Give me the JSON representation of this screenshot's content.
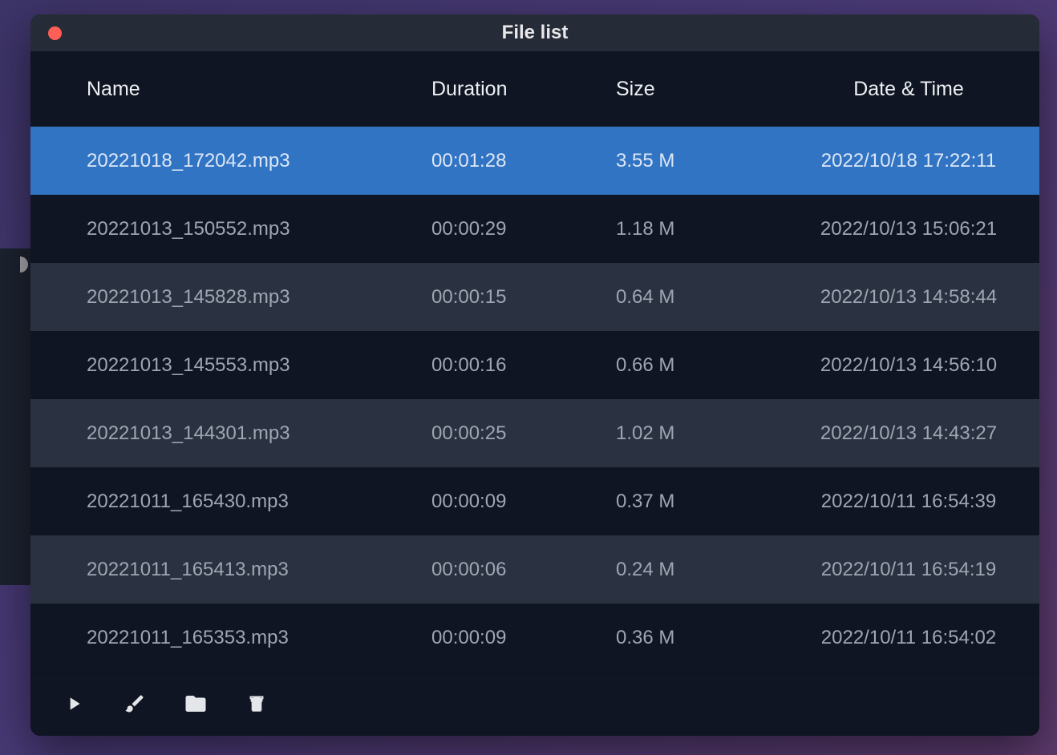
{
  "window": {
    "title": "File list"
  },
  "columns": {
    "name": "Name",
    "duration": "Duration",
    "size": "Size",
    "datetime": "Date & Time"
  },
  "files": [
    {
      "name": "20221018_172042.mp3",
      "duration": "00:01:28",
      "size": "3.55 M",
      "datetime": "2022/10/18 17:22:11",
      "selected": true
    },
    {
      "name": "20221013_150552.mp3",
      "duration": "00:00:29",
      "size": "1.18 M",
      "datetime": "2022/10/13 15:06:21",
      "selected": false
    },
    {
      "name": "20221013_145828.mp3",
      "duration": "00:00:15",
      "size": "0.64 M",
      "datetime": "2022/10/13 14:58:44",
      "selected": false
    },
    {
      "name": "20221013_145553.mp3",
      "duration": "00:00:16",
      "size": "0.66 M",
      "datetime": "2022/10/13 14:56:10",
      "selected": false
    },
    {
      "name": "20221013_144301.mp3",
      "duration": "00:00:25",
      "size": "1.02 M",
      "datetime": "2022/10/13 14:43:27",
      "selected": false
    },
    {
      "name": "20221011_165430.mp3",
      "duration": "00:00:09",
      "size": "0.37 M",
      "datetime": "2022/10/11 16:54:39",
      "selected": false
    },
    {
      "name": "20221011_165413.mp3",
      "duration": "00:00:06",
      "size": "0.24 M",
      "datetime": "2022/10/11 16:54:19",
      "selected": false
    },
    {
      "name": "20221011_165353.mp3",
      "duration": "00:00:09",
      "size": "0.36 M",
      "datetime": "2022/10/11 16:54:02",
      "selected": false
    }
  ],
  "toolbar": {
    "play": "Play",
    "edit": "Edit",
    "folder": "Open folder",
    "delete": "Delete"
  }
}
